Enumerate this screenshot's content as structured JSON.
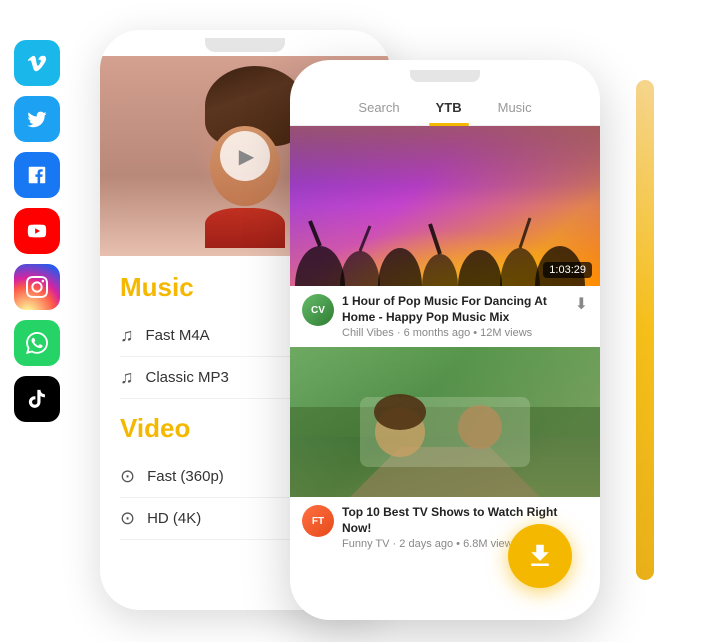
{
  "social": {
    "icons": [
      {
        "name": "vimeo",
        "label": "V",
        "class": "vimeo"
      },
      {
        "name": "twitter",
        "label": "🐦",
        "class": "twitter"
      },
      {
        "name": "facebook",
        "label": "f",
        "class": "facebook"
      },
      {
        "name": "youtube",
        "label": "▶",
        "class": "youtube"
      },
      {
        "name": "instagram",
        "label": "📷",
        "class": "instagram"
      },
      {
        "name": "whatsapp",
        "label": "W",
        "class": "whatsapp"
      },
      {
        "name": "tiktok",
        "label": "♪",
        "class": "tiktok"
      }
    ]
  },
  "phone1": {
    "sections": [
      {
        "title": "Music",
        "items": [
          {
            "icon": "♫",
            "label": "Fast M4A"
          },
          {
            "icon": "♫",
            "label": "Classic MP3"
          }
        ]
      },
      {
        "title": "Video",
        "items": [
          {
            "icon": "⊙",
            "label": "Fast (360p)"
          },
          {
            "icon": "⊙",
            "label": "HD (4K)"
          }
        ]
      }
    ]
  },
  "phone2": {
    "tabs": [
      {
        "label": "Search",
        "active": false
      },
      {
        "label": "YTB",
        "active": true
      },
      {
        "label": "Music",
        "active": false
      }
    ],
    "videos": [
      {
        "duration": "1:03:29",
        "title": "1 Hour of Pop Music For Dancing At Home - Happy Pop Music Mix",
        "channel": "Chill Vibes",
        "meta": "6 months ago • 12M views",
        "avatar_text": "CV"
      },
      {
        "title": "Top 10 Best TV Shows to Watch Right Now!",
        "channel": "Funny TV",
        "meta": "2 days ago • 6.8M views",
        "avatar_text": "FT"
      }
    ],
    "download_icon": "⬇"
  }
}
